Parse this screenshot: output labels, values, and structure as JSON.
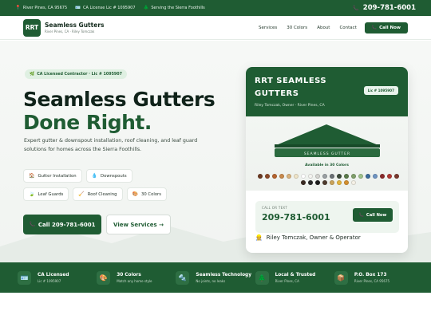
{
  "topbar": {
    "items": [
      {
        "icon": "location-pin-icon",
        "glyph": "📍",
        "text": "River Pines, CA 95675"
      },
      {
        "icon": "id-card-icon",
        "glyph": "🪪",
        "text": "CA License Lic # 1095907"
      },
      {
        "icon": "pine-tree-icon",
        "glyph": "🌲",
        "text": "Serving the Sierra Foothills"
      }
    ],
    "phone_glyph": "📞",
    "phone": "209-781-6001"
  },
  "nav": {
    "logo": "RRT",
    "brand_name": "Seamless Gutters",
    "brand_sub": "River Pines, CA · Riley Tomczak",
    "menu": [
      "Services",
      "30 Colors",
      "About",
      "Contact"
    ],
    "call_glyph": "📞",
    "call_label": "Call Now"
  },
  "hero": {
    "badge_glyph": "🌿",
    "badge": "CA Licensed Contractor · Lic # 1095907",
    "title_line1": "Seamless Gutters",
    "title_line2": "Done Right.",
    "lead": "Expert gutter & downspout installation, roof cleaning, and leaf guard solutions for homes across the Sierra Foothills.",
    "chips": [
      {
        "icon": "house-icon",
        "glyph": "🏠",
        "label": "Gutter Installation"
      },
      {
        "icon": "droplet-icon",
        "glyph": "💧",
        "label": "Downspouts"
      },
      {
        "icon": "leaf-icon",
        "glyph": "🍃",
        "label": "Leaf Guards"
      },
      {
        "icon": "broom-icon",
        "glyph": "🧹",
        "label": "Roof Cleaning"
      },
      {
        "icon": "palette-icon",
        "glyph": "🎨",
        "label": "30 Colors"
      }
    ],
    "primary_glyph": "📞",
    "primary_button": "Call 209-781-6001",
    "secondary_button": "View Services →"
  },
  "card": {
    "title_line1": "RRT SEAMLESS",
    "title_line2": "GUTTERS",
    "subtitle": "Riley Tomczak, Owner · River Pines, CA",
    "license": "Lic # 1095907",
    "gutter_label": "SEAMLESS GUTTER",
    "available": "Available in 30 Colors",
    "swatches": [
      "#6b3a22",
      "#8c4a28",
      "#b5642e",
      "#c98a4b",
      "#d9b27c",
      "#efe4c8",
      "#ffffff",
      "#f4f4f0",
      "#d4d4d0",
      "#9aa0a3",
      "#6a7074",
      "#3d4a3a",
      "#5a7a4a",
      "#7fa06a",
      "#9ec18a",
      "#3a6a9a",
      "#6e95c2",
      "#8a2a2a",
      "#b13a34",
      "#7a3a2e",
      "#3a2a22",
      "#2a2a2a",
      "#1c1c1c",
      "#4e3b2e",
      "#caa45a",
      "#e2b43c",
      "#d4902e",
      "#f5f1e6"
    ],
    "call_label": "CALL OR TEXT",
    "call_number": "209-781-6001",
    "call_glyph": "📞",
    "call_button": "Call Now",
    "owner_glyph": "👷",
    "owner": "Riley Tomczak, Owner & Operator"
  },
  "footer": [
    {
      "icon": "id-card-icon",
      "glyph": "🪪",
      "title": "CA Licensed",
      "sub": "Lic # 1095907"
    },
    {
      "icon": "palette-icon",
      "glyph": "🎨",
      "title": "30 Colors",
      "sub": "Match any home style"
    },
    {
      "icon": "wrench-icon",
      "glyph": "🔩",
      "title": "Seamless Technology",
      "sub": "No joints, no leaks"
    },
    {
      "icon": "pine-tree-icon",
      "glyph": "🌲",
      "title": "Local & Trusted",
      "sub": "River Pines, CA"
    },
    {
      "icon": "mailbox-icon",
      "glyph": "📦",
      "title": "P.O. Box 173",
      "sub": "River Pines, CA 95675"
    }
  ],
  "colors": {
    "brand_green": "#1f5c33",
    "light_green": "#dff0e2"
  }
}
